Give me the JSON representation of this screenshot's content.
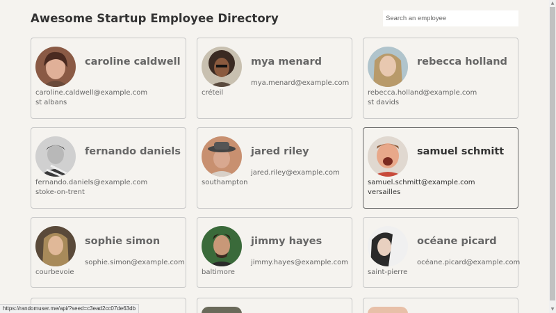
{
  "header": {
    "title": "Awesome Startup Employee Directory"
  },
  "search": {
    "placeholder": "Search an employee"
  },
  "employees": [
    {
      "name": "caroline caldwell",
      "email": "caroline.caldwell@example.com",
      "city": "st albans"
    },
    {
      "name": "mya menard",
      "email": "mya.menard@example.com",
      "city": "créteil"
    },
    {
      "name": "rebecca holland",
      "email": "rebecca.holland@example.com",
      "city": "st davids"
    },
    {
      "name": "fernando daniels",
      "email": "fernando.daniels@example.com",
      "city": "stoke-on-trent"
    },
    {
      "name": "jared riley",
      "email": "jared.riley@example.com",
      "city": "southampton"
    },
    {
      "name": "samuel schmitt",
      "email": "samuel.schmitt@example.com",
      "city": "versailles"
    },
    {
      "name": "sophie simon",
      "email": "sophie.simon@example.com",
      "city": "courbevoie"
    },
    {
      "name": "jimmy hayes",
      "email": "jimmy.hayes@example.com",
      "city": "baltimore"
    },
    {
      "name": "océane picard",
      "email": "océane.picard@example.com",
      "city": "saint-pierre"
    }
  ],
  "status_bar": {
    "url": "https://randomuser.me/api/?seed=c3ead2cc07de63db"
  }
}
